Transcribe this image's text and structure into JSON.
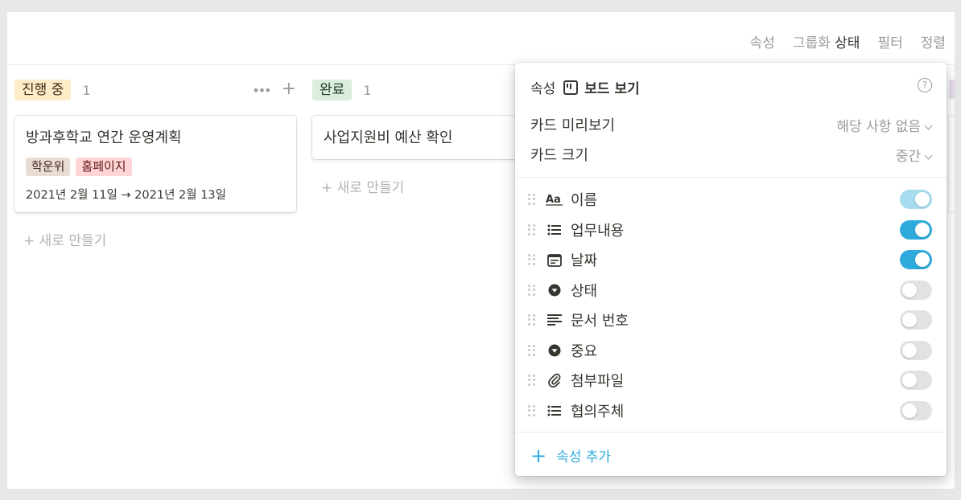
{
  "toolbar": {
    "properties": "속성",
    "group_prefix": "그룹화",
    "group_value": "상태",
    "filter": "필터",
    "sort": "정렬"
  },
  "columns": [
    {
      "label": "진행 중",
      "count": "1",
      "color_bg": "#fdecc8",
      "more_icon": "•••",
      "add_icon": "+",
      "card": {
        "title": "방과후학교 연간 운영계획",
        "tags": [
          {
            "label": "학운위",
            "bg": "#e8dcd5"
          },
          {
            "label": "홈페이지",
            "bg": "#ffd5d5"
          }
        ],
        "date": "2021년 2월 11일 → 2021년 2월 13일"
      },
      "new_label": "+ 새로 만들기"
    },
    {
      "label": "완료",
      "count": "1",
      "color_bg": "#dbeddb",
      "card": {
        "title": "사업지원비 예산 확인"
      },
      "new_label": "+ 새로 만들기"
    }
  ],
  "popup": {
    "prefix": "속성",
    "view_name": "보드 보기",
    "help": "?",
    "card_preview_label": "카드 미리보기",
    "card_preview_value": "해당 사항 없음",
    "card_size_label": "카드 크기",
    "card_size_value": "중간",
    "properties": [
      {
        "name": "이름",
        "icon": "title-icon",
        "state": "locked-on"
      },
      {
        "name": "업무내용",
        "icon": "list-icon",
        "state": "on"
      },
      {
        "name": "날짜",
        "icon": "calendar-icon",
        "state": "on"
      },
      {
        "name": "상태",
        "icon": "select-icon",
        "state": "off"
      },
      {
        "name": "문서 번호",
        "icon": "text-icon",
        "state": "off"
      },
      {
        "name": "중요",
        "icon": "select-icon",
        "state": "off"
      },
      {
        "name": "첨부파일",
        "icon": "attachment-icon",
        "state": "off"
      },
      {
        "name": "협의주체",
        "icon": "list-icon",
        "state": "off"
      }
    ],
    "add_label": "속성 추가"
  },
  "colors": {
    "accent": "#2eaadc",
    "muted_text": "#9b9a97"
  }
}
